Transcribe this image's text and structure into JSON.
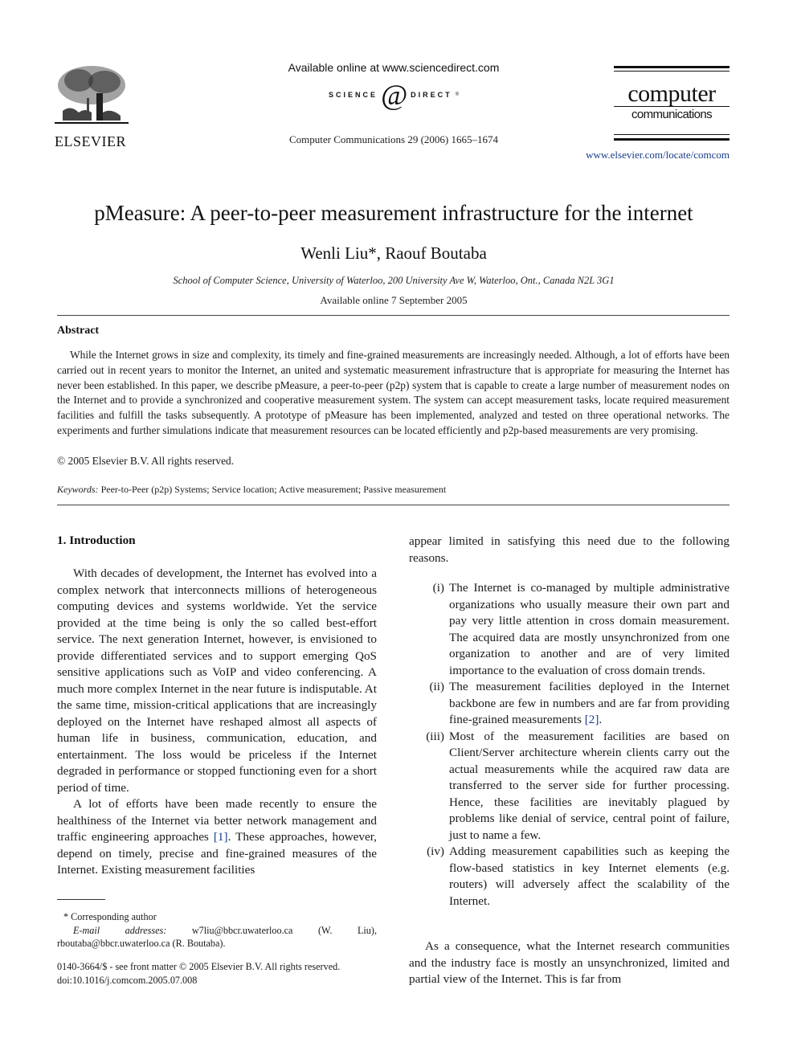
{
  "header": {
    "publisher_logo_text": "ELSEVIER",
    "sciencedirect_available": "Available online at www.sciencedirect.com",
    "sciencedirect_left": "SCIENCE",
    "sciencedirect_at": "d",
    "sciencedirect_right": "DIRECT",
    "sciencedirect_tm": "®",
    "journal_reference": "Computer Communications 29 (2006) 1665–1674",
    "journal_logo_line1": "computer",
    "journal_logo_line2": "communications",
    "journal_url": "www.elsevier.com/locate/comcom"
  },
  "article": {
    "title": "pMeasure: A peer-to-peer measurement infrastructure for the internet",
    "authors": "Wenli Liu*, Raouf Boutaba",
    "affiliation": "School of Computer Science, University of Waterloo, 200 University Ave W, Waterloo, Ont., Canada N2L 3G1",
    "available_online": "Available online 7 September 2005"
  },
  "abstract": {
    "heading": "Abstract",
    "body": "While the Internet grows in size and complexity, its timely and fine-grained measurements are increasingly needed. Although, a lot of efforts have been carried out in recent years to monitor the Internet, an united and systematic measurement infrastructure that is appropriate for measuring the Internet has never been established. In this paper, we describe pMeasure, a peer-to-peer (p2p) system that is capable to create a large number of measurement nodes on the Internet and to provide a synchronized and cooperative measurement system. The system can accept measurement tasks, locate required measurement facilities and fulfill the tasks subsequently. A prototype of pMeasure has been implemented, analyzed and tested on three operational networks. The experiments and further simulations indicate that measurement resources can be located efficiently and p2p-based measurements are very promising.",
    "copyright": "© 2005 Elsevier B.V. All rights reserved.",
    "keywords_label": "Keywords:",
    "keywords": "Peer-to-Peer (p2p) Systems; Service location; Active measurement; Passive measurement"
  },
  "introduction": {
    "heading": "1. Introduction",
    "para1": "With decades of development, the Internet has evolved into a complex network that interconnects millions of heterogeneous computing devices and systems worldwide. Yet the service provided at the time being is only the so called best-effort service. The next generation Internet, however, is envisioned to provide differentiated services and to support emerging QoS sensitive applications such as VoIP and video conferencing. A much more complex Internet in the near future is indisputable. At the same time, mission-critical applications that are increasingly deployed on the Internet have reshaped almost all aspects of human life in business, communication, education, and entertainment. The loss would be priceless if the Internet degraded in performance or stopped functioning even for a short period of time.",
    "para2_a": "A lot of efforts have been made recently to ensure the healthiness of the Internet via better network management and traffic engineering approaches ",
    "para2_ref": "[1]",
    "para2_b": ". These approaches, however, depend on timely, precise and fine-grained measures of the Internet. Existing measurement facilities",
    "right_cont": "appear limited in satisfying this need due to the following reasons.",
    "reasons": [
      {
        "num": "(i)",
        "text": "The Internet is co-managed by multiple administrative organizations who usually measure their own part and pay very little attention in cross domain measurement. The acquired data are mostly unsynchronized from one organization to another and are of very limited importance to the evaluation of cross domain trends.",
        "ref": ""
      },
      {
        "num": "(ii)",
        "text": "The measurement facilities deployed in the Internet backbone are few in numbers and are far from providing fine-grained measurements ",
        "ref": "[2]"
      },
      {
        "num": "(iii)",
        "text": "Most of the measurement facilities are based on Client/Server architecture wherein clients carry out the actual measurements while the acquired raw data are transferred to the server side for further processing. Hence, these facilities are inevitably plagued by problems like denial of service, central point of failure, just to name a few.",
        "ref": ""
      },
      {
        "num": "(iv)",
        "text": "Adding measurement capabilities such as keeping the flow-based statistics in key Internet elements (e.g. routers) will adversely affect the scalability of the Internet.",
        "ref": ""
      }
    ],
    "consequence": "As a consequence, what the Internet research communities and the industry face is mostly an unsynchronized, limited and partial view of the Internet. This is far from"
  },
  "footnotes": {
    "corresponding": "* Corresponding author",
    "email_label": "E-mail addresses:",
    "email_text": " w7liu@bbcr.uwaterloo.ca (W. Liu), rboutaba@bbcr.uwaterloo.ca (R. Boutaba).",
    "front_matter": "0140-3664/$ - see front matter © 2005 Elsevier B.V. All rights reserved.",
    "doi": "doi:10.1016/j.comcom.2005.07.008"
  },
  "colors": {
    "link": "#1a3c8a",
    "text": "#1a1a1a"
  }
}
